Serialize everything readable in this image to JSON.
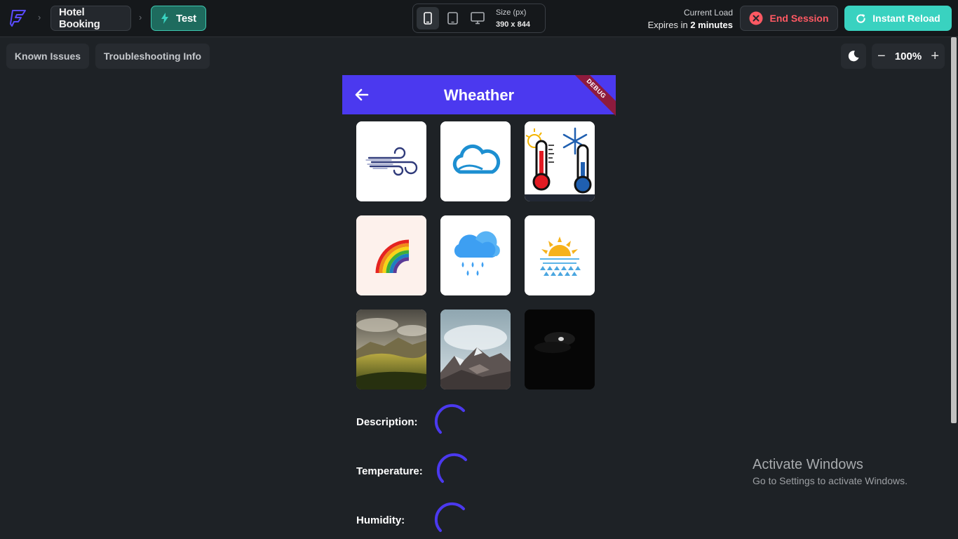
{
  "topbar": {
    "project_name": "Hotel Booking",
    "mode_label": "Test",
    "size_label": "Size (px)",
    "size_value": "390 x 844",
    "current_load": "Current Load",
    "expires_prefix": "Expires in",
    "expires_value": "2 minutes",
    "end_session_label": "End Session",
    "instant_reload_label": "Instant Reload"
  },
  "toolbar": {
    "known_issues_label": "Known Issues",
    "troubleshooting_label": "Troubleshooting Info",
    "zoom_minus": "−",
    "zoom_value": "100%",
    "zoom_plus": "+"
  },
  "app": {
    "title": "Wheather",
    "debug_banner": "DEBUG",
    "tiles": [
      {
        "icon": "wind-icon"
      },
      {
        "icon": "cloud-icon"
      },
      {
        "icon": "hot-cold-thermometer-icon"
      },
      {
        "icon": "rainbow-icon"
      },
      {
        "icon": "rain-cloud-icon"
      },
      {
        "icon": "sunrise-icon"
      },
      {
        "icon": "landscape-photo"
      },
      {
        "icon": "mountain-photo"
      },
      {
        "icon": "night-photo"
      }
    ],
    "fields": [
      {
        "label": "Description:"
      },
      {
        "label": "Temperature:"
      },
      {
        "label": "Humidity:"
      }
    ]
  },
  "os_watermark": {
    "line1": "Activate Windows",
    "line2": "Go to Settings to activate Windows."
  },
  "colors": {
    "primary": "#4b39ef",
    "teal": "#39d2c0",
    "danger": "#ff5963",
    "background": "#1e2226"
  }
}
